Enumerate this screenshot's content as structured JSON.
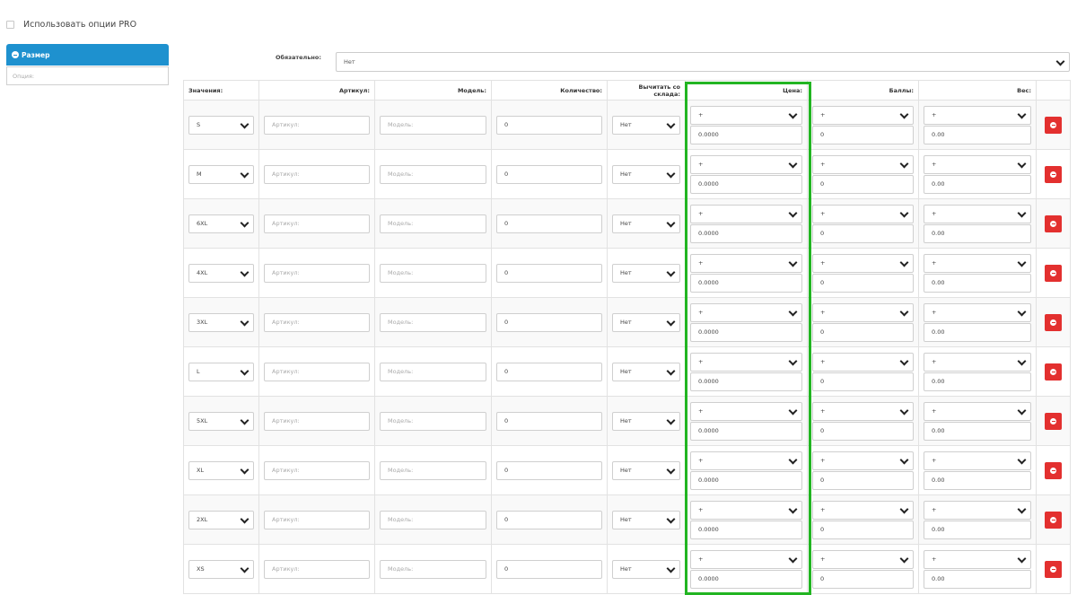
{
  "pro": {
    "label": "Использовать опции PRO"
  },
  "option_tab": {
    "label": "Размер"
  },
  "option_input": {
    "placeholder": "Опция:"
  },
  "required": {
    "label": "Обязательно:",
    "value": "Нет"
  },
  "headers": {
    "values": "Значения:",
    "sku": "Артикул:",
    "model": "Модель:",
    "quantity": "Количество:",
    "subtract": "Вычитать со склада:",
    "price": "Цена:",
    "points": "Баллы:",
    "weight": "Вес:"
  },
  "placeholders": {
    "sku": "Артикул:",
    "model": "Модель:"
  },
  "accent_colors": {
    "tab": "#1e91cf",
    "delete": "#e3302f",
    "highlight": "#22b522"
  },
  "rows": [
    {
      "value": "S",
      "quantity": "0",
      "subtract": "Нет",
      "price_prefix": "+",
      "price": "0.0000",
      "points_prefix": "+",
      "points": "0",
      "weight_prefix": "+",
      "weight": "0.00"
    },
    {
      "value": "M",
      "quantity": "0",
      "subtract": "Нет",
      "price_prefix": "+",
      "price": "0.0000",
      "points_prefix": "+",
      "points": "0",
      "weight_prefix": "+",
      "weight": "0.00"
    },
    {
      "value": "6XL",
      "quantity": "0",
      "subtract": "Нет",
      "price_prefix": "+",
      "price": "0.0000",
      "points_prefix": "+",
      "points": "0",
      "weight_prefix": "+",
      "weight": "0.00"
    },
    {
      "value": "4XL",
      "quantity": "0",
      "subtract": "Нет",
      "price_prefix": "+",
      "price": "0.0000",
      "points_prefix": "+",
      "points": "0",
      "weight_prefix": "+",
      "weight": "0.00"
    },
    {
      "value": "3XL",
      "quantity": "0",
      "subtract": "Нет",
      "price_prefix": "+",
      "price": "0.0000",
      "points_prefix": "+",
      "points": "0",
      "weight_prefix": "+",
      "weight": "0.00"
    },
    {
      "value": "L",
      "quantity": "0",
      "subtract": "Нет",
      "price_prefix": "+",
      "price": "0.0000",
      "points_prefix": "+",
      "points": "0",
      "weight_prefix": "+",
      "weight": "0.00"
    },
    {
      "value": "5XL",
      "quantity": "0",
      "subtract": "Нет",
      "price_prefix": "+",
      "price": "0.0000",
      "points_prefix": "+",
      "points": "0",
      "weight_prefix": "+",
      "weight": "0.00"
    },
    {
      "value": "XL",
      "quantity": "0",
      "subtract": "Нет",
      "price_prefix": "+",
      "price": "0.0000",
      "points_prefix": "+",
      "points": "0",
      "weight_prefix": "+",
      "weight": "0.00"
    },
    {
      "value": "2XL",
      "quantity": "0",
      "subtract": "Нет",
      "price_prefix": "+",
      "price": "0.0000",
      "points_prefix": "+",
      "points": "0",
      "weight_prefix": "+",
      "weight": "0.00"
    },
    {
      "value": "XS",
      "quantity": "0",
      "subtract": "Нет",
      "price_prefix": "+",
      "price": "0.0000",
      "points_prefix": "+",
      "points": "0",
      "weight_prefix": "+",
      "weight": "0.00"
    }
  ]
}
